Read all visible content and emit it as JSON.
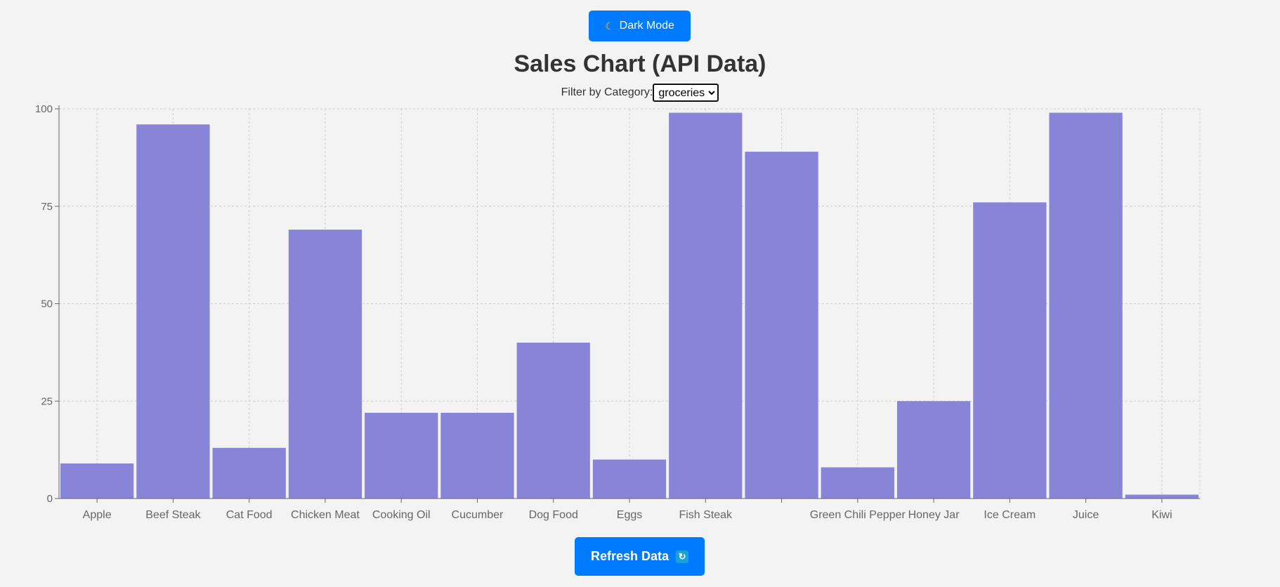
{
  "header": {
    "dark_mode_label": "Dark Mode",
    "dark_mode_icon": "moon-icon",
    "title": "Sales Chart (API Data)"
  },
  "filter": {
    "label": "Filter by Category:",
    "selected": "groceries"
  },
  "footer": {
    "refresh_label": "Refresh Data",
    "refresh_icon": "refresh-icon"
  },
  "colors": {
    "bar": "#8884d8",
    "button": "#007bff",
    "grid": "#cccccc"
  },
  "chart_data": {
    "type": "bar",
    "categories": [
      "Apple",
      "Beef Steak",
      "Cat Food",
      "Chicken Meat",
      "Cooking Oil",
      "Cucumber",
      "Dog Food",
      "Eggs",
      "Fish Steak",
      "",
      "Green Chili Pepper",
      "Honey Jar",
      "Ice Cream",
      "Juice",
      "Kiwi"
    ],
    "values": [
      9,
      96,
      13,
      69,
      22,
      22,
      40,
      10,
      99,
      89,
      8,
      25,
      76,
      99,
      1
    ],
    "yticks": [
      0,
      25,
      50,
      75,
      100
    ],
    "ylim": [
      0,
      100
    ],
    "grid": true
  }
}
